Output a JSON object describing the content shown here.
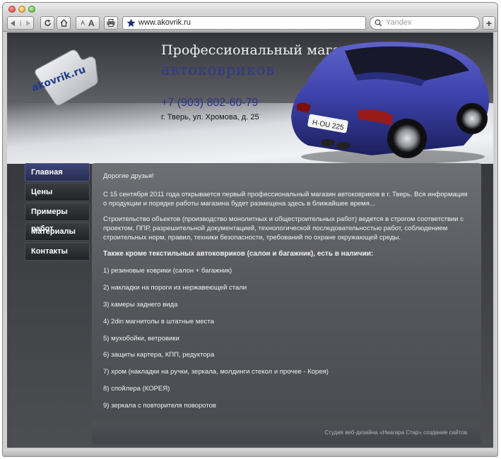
{
  "browser": {
    "url": "www.akovrik.ru",
    "search_placeholder": "Yandex",
    "font_small_label": "A",
    "font_large_label": "A",
    "new_tab_label": "+"
  },
  "site": {
    "logo_text": "akovrik.ru",
    "title_line1": "Профессиональный магазин",
    "title_line2": "автоковриков",
    "phone": "+7 (903) 802-60-79",
    "address": "г. Тверь, ул. Хромова, д. 25",
    "car_plate": "H·OU 225"
  },
  "menu": {
    "items": [
      {
        "label": "Главная",
        "active": true
      },
      {
        "label": "Цены"
      },
      {
        "label": "Примеры работ"
      },
      {
        "label": "Материалы"
      },
      {
        "label": "Контакты"
      }
    ]
  },
  "content": {
    "greeting": "Дорогие друзья!",
    "paragraph1": "С 15 сентября 2011 года открывается первый профессиональный магазин автоковриков в г. Тверь. Вся информация о продукции и порядке работы магазина будет размещена здесь в ближайшее время...",
    "paragraph2": "Строительство объектов (производство монолитных и общестроительных работ) ведется в строгом соответствии с проектом, ППР, разрешительной документацией, технологической последовательностью работ, соблюдением строительных норм, правил, техники безопасности, требований по охране окружающей среды.",
    "lead": "Также кроме текстильных автоковриков (салон и багажник), есть в наличии:",
    "items": [
      "1) резиновые коврики (салон + багажник)",
      "2) накладки на пороги из нержавеющей стали",
      "3) камеры заднего вида",
      "4) 2din магнитолы в штатные места",
      "5) мухобойки, ветровики",
      "6) защиты картера, КПП, редуктора",
      "7) хром (накладки на ручки, зеркала, молдинги стекол и прочее - Корея)",
      "8) спойлера (КОРЕЯ)",
      "9) зеркала с повторителя поворотов"
    ]
  },
  "footer": {
    "text": "Студия веб-дизайна «Ниагара Стар» создание сайтов"
  },
  "colors": {
    "accent_blue": "#2a3388",
    "car_blue": "#3a40a8",
    "menu_active": "#3e4577"
  }
}
